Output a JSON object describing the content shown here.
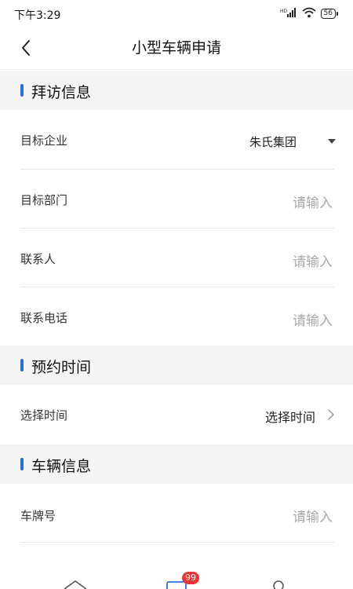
{
  "status_bar": {
    "time": "下午3:29",
    "network": "HD",
    "battery": "56"
  },
  "nav": {
    "title": "小型车辆申请",
    "back_icon": "chevron-left-icon"
  },
  "sections": {
    "visit": {
      "title": "拜访信息",
      "rows": {
        "company": {
          "label": "目标企业",
          "value": "朱氏集团"
        },
        "department": {
          "label": "目标部门",
          "placeholder": "请输入"
        },
        "contact": {
          "label": "联系人",
          "placeholder": "请输入"
        },
        "phone": {
          "label": "联系电话",
          "placeholder": "请输入"
        }
      }
    },
    "appointment": {
      "title": "预约时间",
      "rows": {
        "time": {
          "label": "选择时间",
          "value": "选择时间"
        }
      }
    },
    "vehicle": {
      "title": "车辆信息",
      "rows": {
        "plate": {
          "label": "车牌号",
          "placeholder": "请输入"
        }
      }
    }
  },
  "bottom_bar": {
    "badge": "99"
  },
  "colors": {
    "accent": "#2b6fd6",
    "badge": "#e33333",
    "section_bg": "#f4f4f4",
    "placeholder": "#a9a9a9"
  }
}
